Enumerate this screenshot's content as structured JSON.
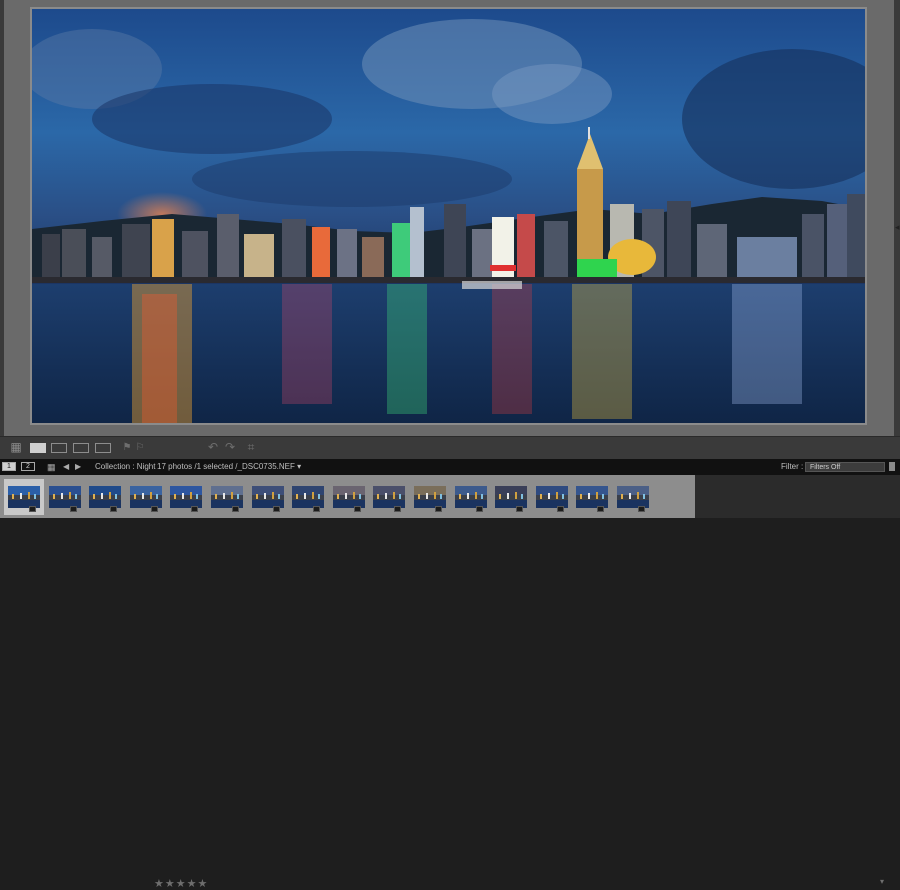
{
  "filmbar": {
    "monitor_1": "1",
    "monitor_2": "2",
    "source": "Collection : Night",
    "status_prefix": "17 photos /1 selected /",
    "filename": "_DSC0735.NEF",
    "filter_label": "Filter :",
    "filter_value": "Filters Off"
  },
  "toolbar": {
    "rating": "★★★★★",
    "icons": [
      "grid-view-icon",
      "loupe-view-icon",
      "compare-view-icon",
      "survey-view-icon",
      "people-view-icon",
      "flag-pick-icon",
      "flag-reject-icon",
      "rotate-left-icon",
      "rotate-right-icon",
      "crop-icon"
    ]
  },
  "filmstrip": {
    "thumb_count": 16,
    "selected_index": 0
  },
  "colors": {
    "panel_bg": "#6a6a6a",
    "toolbar_bg": "#3a3a3a",
    "filmbar_bg": "#111111",
    "filmstrip_bg": "#8d8d8d"
  }
}
